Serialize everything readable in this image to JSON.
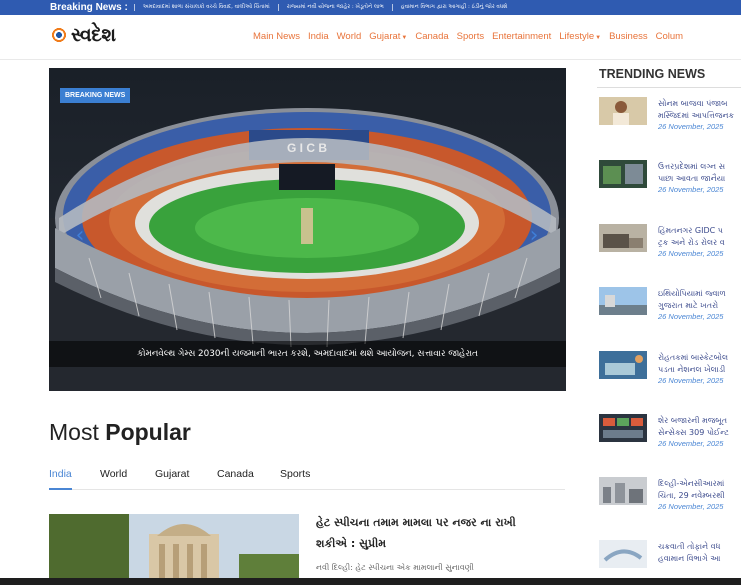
{
  "ticker": {
    "label": "Breaking News :",
    "items": [
      "અમદાવાદમાં શાળા સંચાલકો વચ્ચે વિવાદ, વાલીઓ ચિંતામાં",
      "રાજ્યમાં નવી યોજના જાહેર : ખેડૂતોને લાભ",
      "હવામાન વિભાગ દ્વારા આગાહી : ઠંડીનું જોર વધશે"
    ]
  },
  "brand": {
    "name": "સ્વદેશ"
  },
  "nav": {
    "items": [
      {
        "label": "Main News"
      },
      {
        "label": "India"
      },
      {
        "label": "World"
      },
      {
        "label": "Gujarat",
        "dropdown": true
      },
      {
        "label": "Canada"
      },
      {
        "label": "Sports"
      },
      {
        "label": "Entertainment"
      },
      {
        "label": "Lifestyle",
        "dropdown": true
      },
      {
        "label": "Business"
      },
      {
        "label": "Colum"
      }
    ]
  },
  "hero": {
    "badge": "BREAKING NEWS",
    "caption": "કોમનવેલ્થ ગેમ્સ 2030ની યજમાની ભારત કરશે, અમદાવાદમાં થશે આયોજન, સત્તાવાર જાહેરાત",
    "stadium_sign": "G I C B",
    "prev_icon": "chevron-left-icon",
    "next_icon": "chevron-right-icon"
  },
  "trending": {
    "title": "TRENDING NEWS",
    "items": [
      {
        "title": "સોનમ બાજવા પંજાબ",
        "title2": "મસ્જિદમાં આપત્તિજનક",
        "date": "26 November, 2025"
      },
      {
        "title": "ઉત્તરપ્રદેશમાં લગ્ન સ",
        "title2": "પાછા આવતા જાનૈયા",
        "date": "26 November, 2025"
      },
      {
        "title": "હિંમતનગર GIDC પ",
        "title2": "ટ્રક અને રોડ રોલર વ",
        "date": "26 November, 2025"
      },
      {
        "title": "ઇથિયોપિયામાં જ્વાળ",
        "title2": "ગુજરાત માટે ખતરો",
        "date": "26 November, 2025"
      },
      {
        "title": "રોહતકમાં બાસ્કેટબોલ",
        "title2": "પડતા નેશનલ ખેલાડી",
        "date": "26 November, 2025"
      },
      {
        "title": "શેર બજારની મજબૂત",
        "title2": "સેન્સેક્સ 309 પોઈન્ટ",
        "date": "26 November, 2025"
      },
      {
        "title": "દિલ્હી-એનસીઆરમાં",
        "title2": "ચિંતા, 29 નવેમ્બરથી",
        "date": "26 November, 2025"
      },
      {
        "title": "ચક્રવાતી તોફાને વધ",
        "title2": "હવામાન વિભાગે આ",
        "date": "26 November, 2025"
      }
    ]
  },
  "most_popular": {
    "title_light": "Most",
    "title_bold": "Popular",
    "tabs": [
      {
        "label": "India",
        "active": true
      },
      {
        "label": "World"
      },
      {
        "label": "Gujarat"
      },
      {
        "label": "Canada"
      },
      {
        "label": "Sports"
      }
    ],
    "article": {
      "title_line1": "હેટ સ્પીચના તમામ મામલા પર નજર ના રાખી",
      "title_line2": "શકીએ : સુપ્રીમ",
      "excerpt": "નવી દિલ્હી: હેટ સ્પીચના એક મામલાની સુનાવણી"
    }
  },
  "colors": {
    "ticker_bg": "#2f5bb1",
    "nav_text": "#e8743b",
    "accent_blue": "#4a86d4",
    "trend_title": "#3b4a8c"
  }
}
